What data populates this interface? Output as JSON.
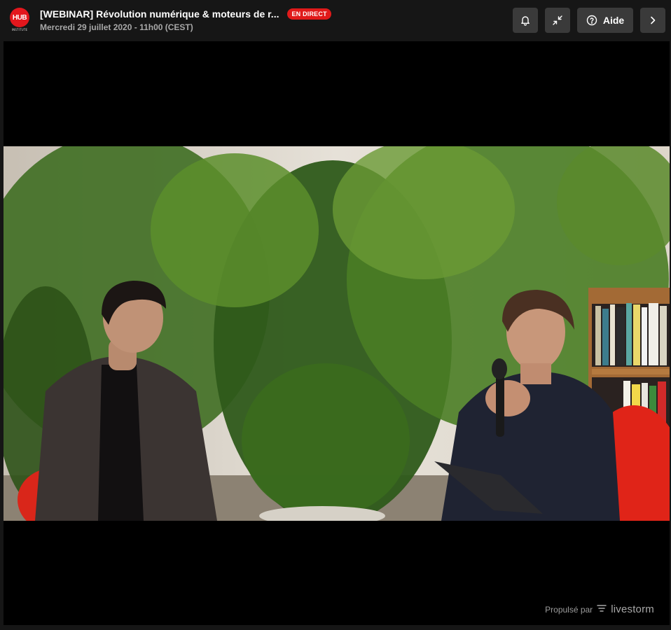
{
  "header": {
    "logo_text": "HUB",
    "logo_sub": "INSTITUTE",
    "event_title": "[WEBINAR] Révolution numérique & moteurs de r...",
    "live_badge": "EN DIRECT",
    "event_date": "Mercredi 29 juillet 2020 - 11h00 (CEST)",
    "buttons": {
      "notifications_icon": "bell-icon",
      "minimize_icon": "collapse-arrows-icon",
      "help_label": "Aide",
      "help_icon": "question-circle-icon",
      "next_icon": "chevron-right-icon"
    }
  },
  "player": {
    "powered_by_label": "Propulsé par",
    "powered_by_brand": "livestorm"
  },
  "colors": {
    "brand_red": "#e3171d",
    "live_red": "#e01a1a",
    "button_bg": "#3a3a3a",
    "header_bg": "#161616"
  }
}
